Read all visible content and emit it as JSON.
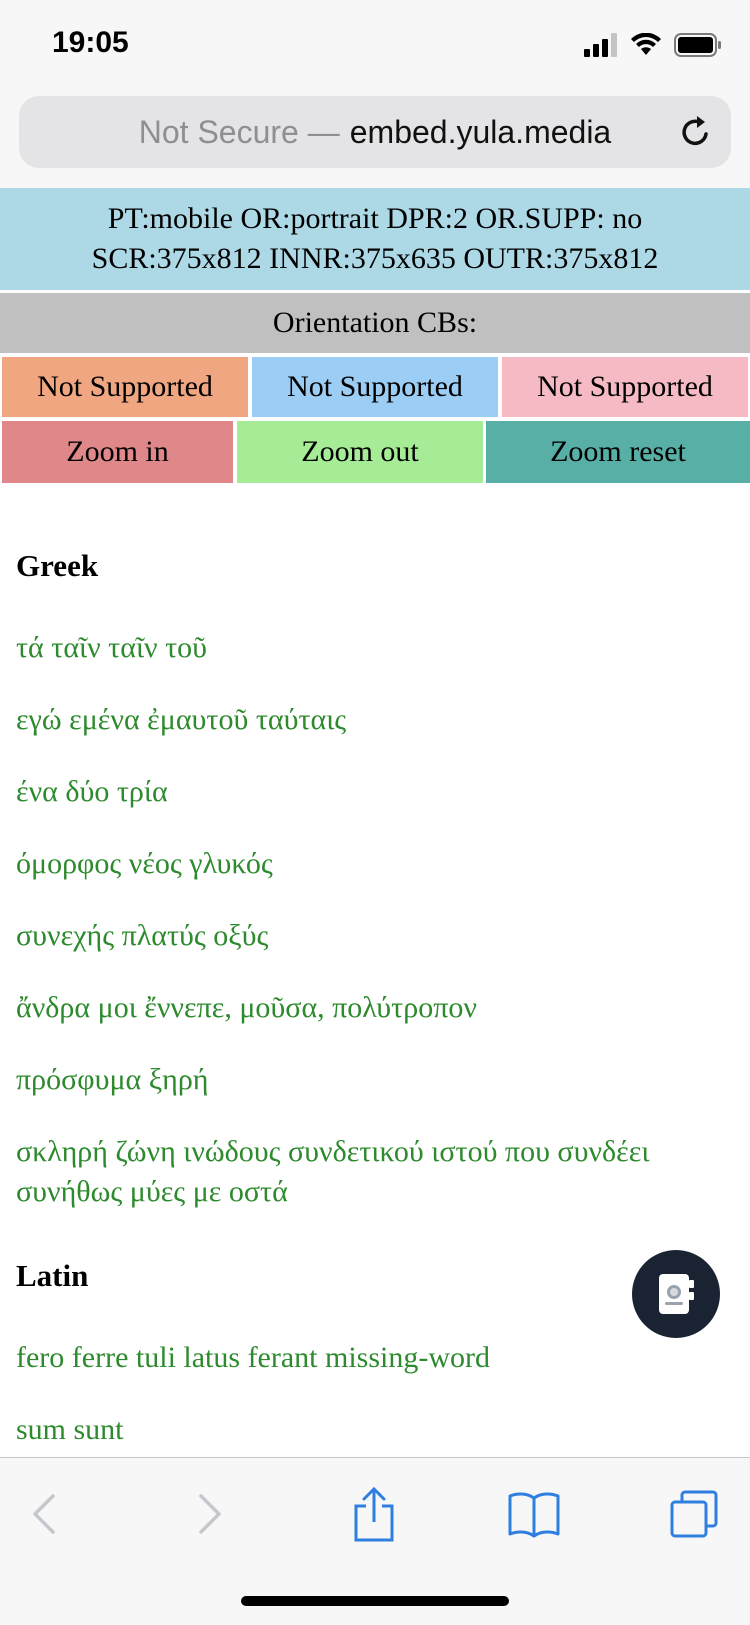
{
  "status": {
    "time": "19:05",
    "icons": [
      "signal-icon",
      "wifi-icon",
      "battery-icon"
    ]
  },
  "address": {
    "secure_label": "Not Secure —",
    "domain": "embed.yula.media",
    "reload_icon": "reload-icon"
  },
  "info": {
    "line1": "PT:mobile OR:portrait DPR:2 OR.SUPP: no",
    "line2": "SCR:375x812 INNR:375x635 OUTR:375x812"
  },
  "orientation": {
    "header": "Orientation CBs:",
    "cells": [
      {
        "label": "Not Supported",
        "color": "#f0a680"
      },
      {
        "label": "Not Supported",
        "color": "#9ccdf5"
      },
      {
        "label": "Not Supported",
        "color": "#f5bac4"
      }
    ]
  },
  "zoom": {
    "buttons": [
      {
        "label": "Zoom in",
        "color": "#e0878a"
      },
      {
        "label": "Zoom out",
        "color": "#a6ec96"
      },
      {
        "label": "Zoom reset",
        "color": "#57afa5"
      }
    ]
  },
  "sections": {
    "greek": {
      "heading": "Greek",
      "phrases": [
        "τά ταῖν ταῖν τοῦ",
        "εγώ εμένα ἐμαυτοῦ ταύταις",
        "ένα δύο τρία",
        "όμορφος νέος γλυκός",
        "συνεχής πλατύς οξύς",
        "ἄνδρα μοι ἔννεπε, μοῦσα, πολύτροπον",
        "πρόσφυμα ξηρή",
        "σκληρή ζώνη ινώδους συνδετικού ιστού που συνδέει συνήθως μύες με οστά"
      ]
    },
    "latin": {
      "heading": "Latin",
      "phrases": [
        "fero ferre tuli latus ferant missing-word",
        "sum sunt"
      ]
    }
  },
  "fab_icon": "contact-book-icon",
  "toolbar": {
    "icons": [
      "back-arrow-icon",
      "forward-arrow-icon",
      "share-icon",
      "bookmarks-icon",
      "tabs-icon"
    ]
  },
  "colors": {
    "phrase_text": "#2d8a2d",
    "info_bg": "#add8e6",
    "cb_header_bg": "#c0c0c0"
  }
}
